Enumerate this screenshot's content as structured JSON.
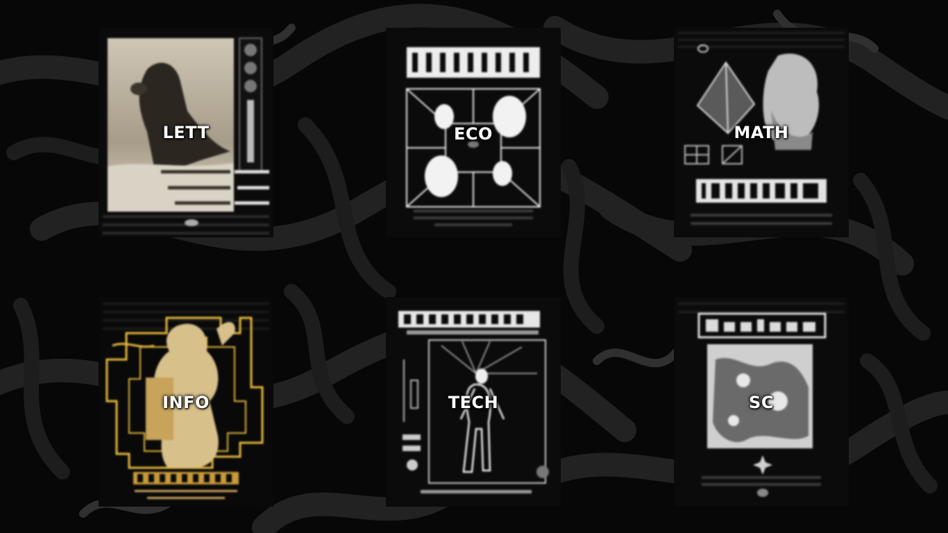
{
  "cards": [
    {
      "label": "LETT"
    },
    {
      "label": "ECO"
    },
    {
      "label": "MATH"
    },
    {
      "label": "INFO"
    },
    {
      "label": "TECH"
    },
    {
      "label": "SC"
    }
  ],
  "colors": {
    "background": "#070707",
    "graffiti": "#2a2a2a",
    "accent_gold": "#e6b93a",
    "text": "#ffffff"
  }
}
